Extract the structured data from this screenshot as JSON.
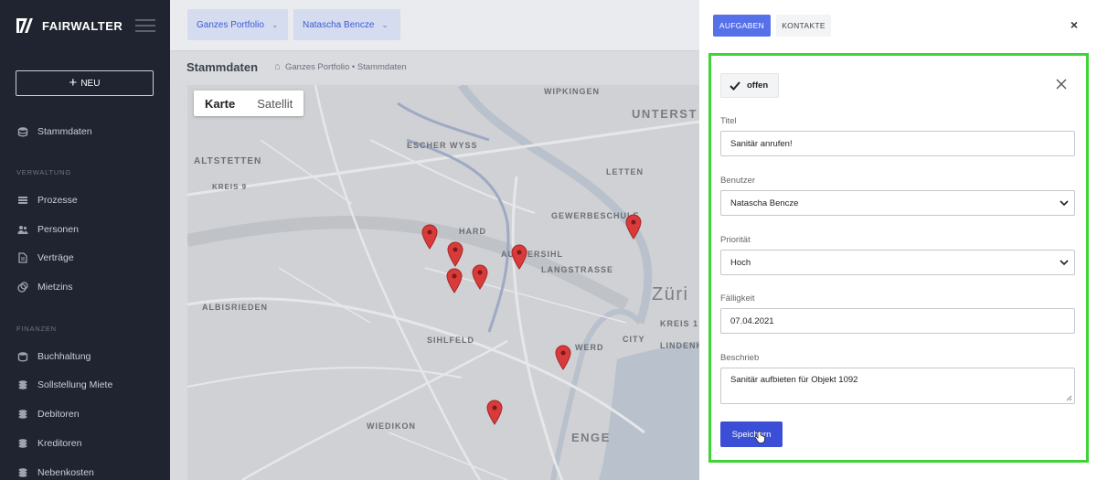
{
  "app": {
    "brand": "FAIRWALTER"
  },
  "sidebar": {
    "new_label": "NEU",
    "items_top": [
      {
        "label": "Stammdaten",
        "icon": "database-icon"
      }
    ],
    "section_verwaltung": "VERWALTUNG",
    "items_verwaltung": [
      {
        "label": "Prozesse",
        "icon": "list-icon"
      },
      {
        "label": "Personen",
        "icon": "people-icon"
      },
      {
        "label": "Verträge",
        "icon": "document-icon"
      },
      {
        "label": "Mietzins",
        "icon": "coins-icon"
      }
    ],
    "section_finanzen": "FINANZEN",
    "items_finanzen": [
      {
        "label": "Buchhaltung",
        "icon": "database-icon"
      },
      {
        "label": "Sollstellung Miete",
        "icon": "coins-icon"
      },
      {
        "label": "Debitoren",
        "icon": "coins-icon"
      },
      {
        "label": "Kreditoren",
        "icon": "coins-icon"
      },
      {
        "label": "Nebenkosten",
        "icon": "coins-icon"
      }
    ]
  },
  "header": {
    "portfolio_filter": "Ganzes Portfolio",
    "user_filter": "Natascha Bencze"
  },
  "breadcrumb": {
    "title": "Stammdaten",
    "path": "Ganzes Portfolio • Stammdaten"
  },
  "map": {
    "type_map": "Karte",
    "type_satellite": "Satellit",
    "labels": {
      "altstetten": "ALTSTETTEN",
      "kreis9": "KREIS 9",
      "albisrieden": "ALBISRIEDEN",
      "escher": "ESCHER WYSS",
      "hard": "HARD",
      "aussersihl": "AUSSERSIHL",
      "langstrasse": "LANGSTRASSE",
      "gewerbeschule": "GEWERBESCHULE",
      "letten": "LETTEN",
      "wipkingen": "WIPKINGEN",
      "unterstrass": "UNTERST",
      "sihlfeld": "SIHLFELD",
      "wiedikon": "WIEDIKON",
      "enge": "ENGE",
      "city": "CITY",
      "lindenhof": "LINDENH",
      "kreis1": "KREIS 1",
      "werd": "WERD",
      "zurich": "Züri"
    }
  },
  "panel": {
    "tab_tasks": "AUFGABEN",
    "tab_contacts": "KONTAKTE",
    "status_label": "offen",
    "title_label": "Titel",
    "title_value": "Sanitär anrufen!",
    "user_label": "Benutzer",
    "user_value": "Natascha Bencze",
    "priority_label": "Priorität",
    "priority_value": "Hoch",
    "due_label": "Fälligkeit",
    "due_value": "07.04.2021",
    "description_label": "Beschrieb",
    "description_value": "Sanitär aufbieten für Objekt 1092",
    "save_label": "Speichern"
  },
  "colors": {
    "accent": "#5570e8",
    "save": "#3b4fd6",
    "highlight_border": "#3fd436",
    "marker": "#d93a3a"
  }
}
